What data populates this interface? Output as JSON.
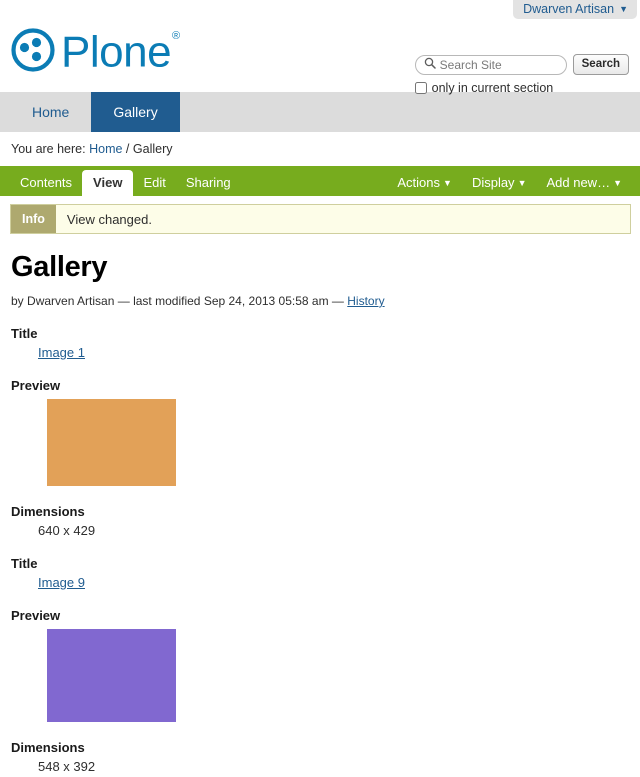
{
  "personal_bar": {
    "user_label": "Dwarven Artisan",
    "caret": "▼"
  },
  "header": {
    "logo_text": "Plone",
    "logo_registered": "®",
    "logo_icon": "plone-logo-icon",
    "brand_color": "#0b7cb5"
  },
  "search": {
    "icon": "search-icon",
    "placeholder": "Search Site",
    "value": "",
    "button_label": "Search",
    "checkbox_label": "only in current section",
    "checkbox_checked": false
  },
  "globalnav": {
    "tabs": [
      {
        "label": "Home",
        "selected": false
      },
      {
        "label": "Gallery",
        "selected": true
      }
    ],
    "selected_color": "#205c90"
  },
  "breadcrumb": {
    "prefix": "You are here:",
    "home": "Home",
    "separator": "/",
    "current": "Gallery"
  },
  "contentbar": {
    "color": "#77ac1e",
    "left_items": [
      {
        "label": "Contents",
        "active": false
      },
      {
        "label": "View",
        "active": true
      },
      {
        "label": "Edit",
        "active": false
      },
      {
        "label": "Sharing",
        "active": false
      }
    ],
    "right_items": [
      {
        "label": "Actions",
        "caret": "▼"
      },
      {
        "label": "Display",
        "caret": "▼"
      },
      {
        "label": "Add new…",
        "caret": "▼"
      }
    ]
  },
  "message": {
    "label": "Info",
    "text": "View changed.",
    "label_color": "#aea96f",
    "background": "#fdfde8"
  },
  "document": {
    "title": "Gallery",
    "byline_prefix": "by",
    "author": "Dwarven Artisan",
    "byline_dash": "—",
    "modified_prefix": "last modified",
    "modified_date": "Sep 24, 2013 05:58 am",
    "history_link": "History"
  },
  "items": [
    {
      "title_label": "Title",
      "title_value": "Image 1",
      "preview_label": "Preview",
      "preview_color": "#e2a158",
      "preview_w": 129,
      "preview_h": 87,
      "dimensions_label": "Dimensions",
      "dimensions_value": "640 x 429"
    },
    {
      "title_label": "Title",
      "title_value": "Image 9",
      "preview_label": "Preview",
      "preview_color": "#8168d0",
      "preview_w": 129,
      "preview_h": 93,
      "dimensions_label": "Dimensions",
      "dimensions_value": "548 x 392"
    }
  ]
}
